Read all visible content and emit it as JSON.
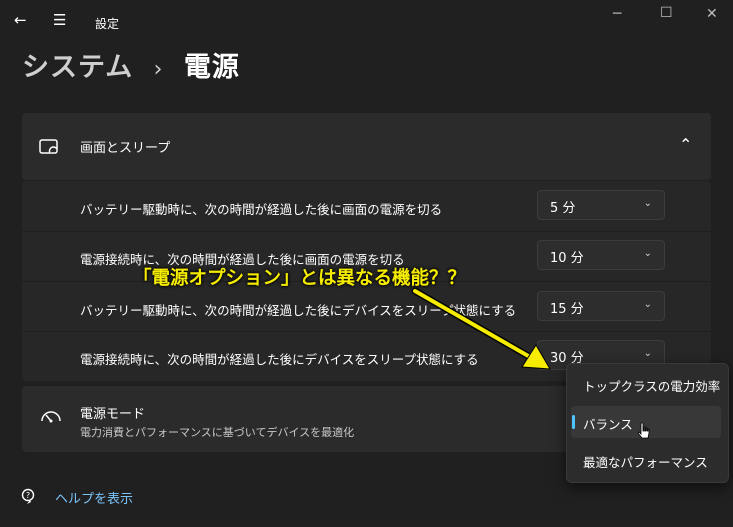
{
  "window": {
    "app_title": "設定",
    "back_glyph": "←",
    "menu_glyph": "☰",
    "minimize_glyph": "─",
    "maximize_glyph": "☐",
    "close_glyph": "✕"
  },
  "breadcrumb": {
    "parent": "システム",
    "separator": "›",
    "current": "電源"
  },
  "screen_sleep": {
    "title": "画面とスリープ",
    "collapse_glyph": "⌃",
    "rows": [
      {
        "label": "バッテリー駆動時に、次の時間が経過した後に画面の電源を切る",
        "value": "5 分"
      },
      {
        "label": "電源接続時に、次の時間が経過した後に画面の電源を切る",
        "value": "10 分"
      },
      {
        "label": "バッテリー駆動時に、次の時間が経過した後にデバイスをスリープ状態にする",
        "value": "15 分"
      },
      {
        "label": "電源接続時に、次の時間が経過した後にデバイスをスリープ状態にする",
        "value": "30 分"
      }
    ],
    "chevron_glyph": "⌄"
  },
  "power_mode": {
    "title": "電源モード",
    "description": "電力消費とパフォーマンスに基づいてデバイスを最適化",
    "options": [
      "トップクラスの電力効率",
      "バランス",
      "最適なパフォーマンス"
    ],
    "selected": "バランス"
  },
  "annotation": {
    "text": "「電源オプション」とは異なる機能？？",
    "color": "#f5ec00"
  },
  "help": {
    "label": "ヘルプを表示"
  },
  "colors": {
    "background": "#202020",
    "card": "#2b2b2b",
    "accent": "#4cc2ff",
    "link": "#7cc4f8"
  }
}
